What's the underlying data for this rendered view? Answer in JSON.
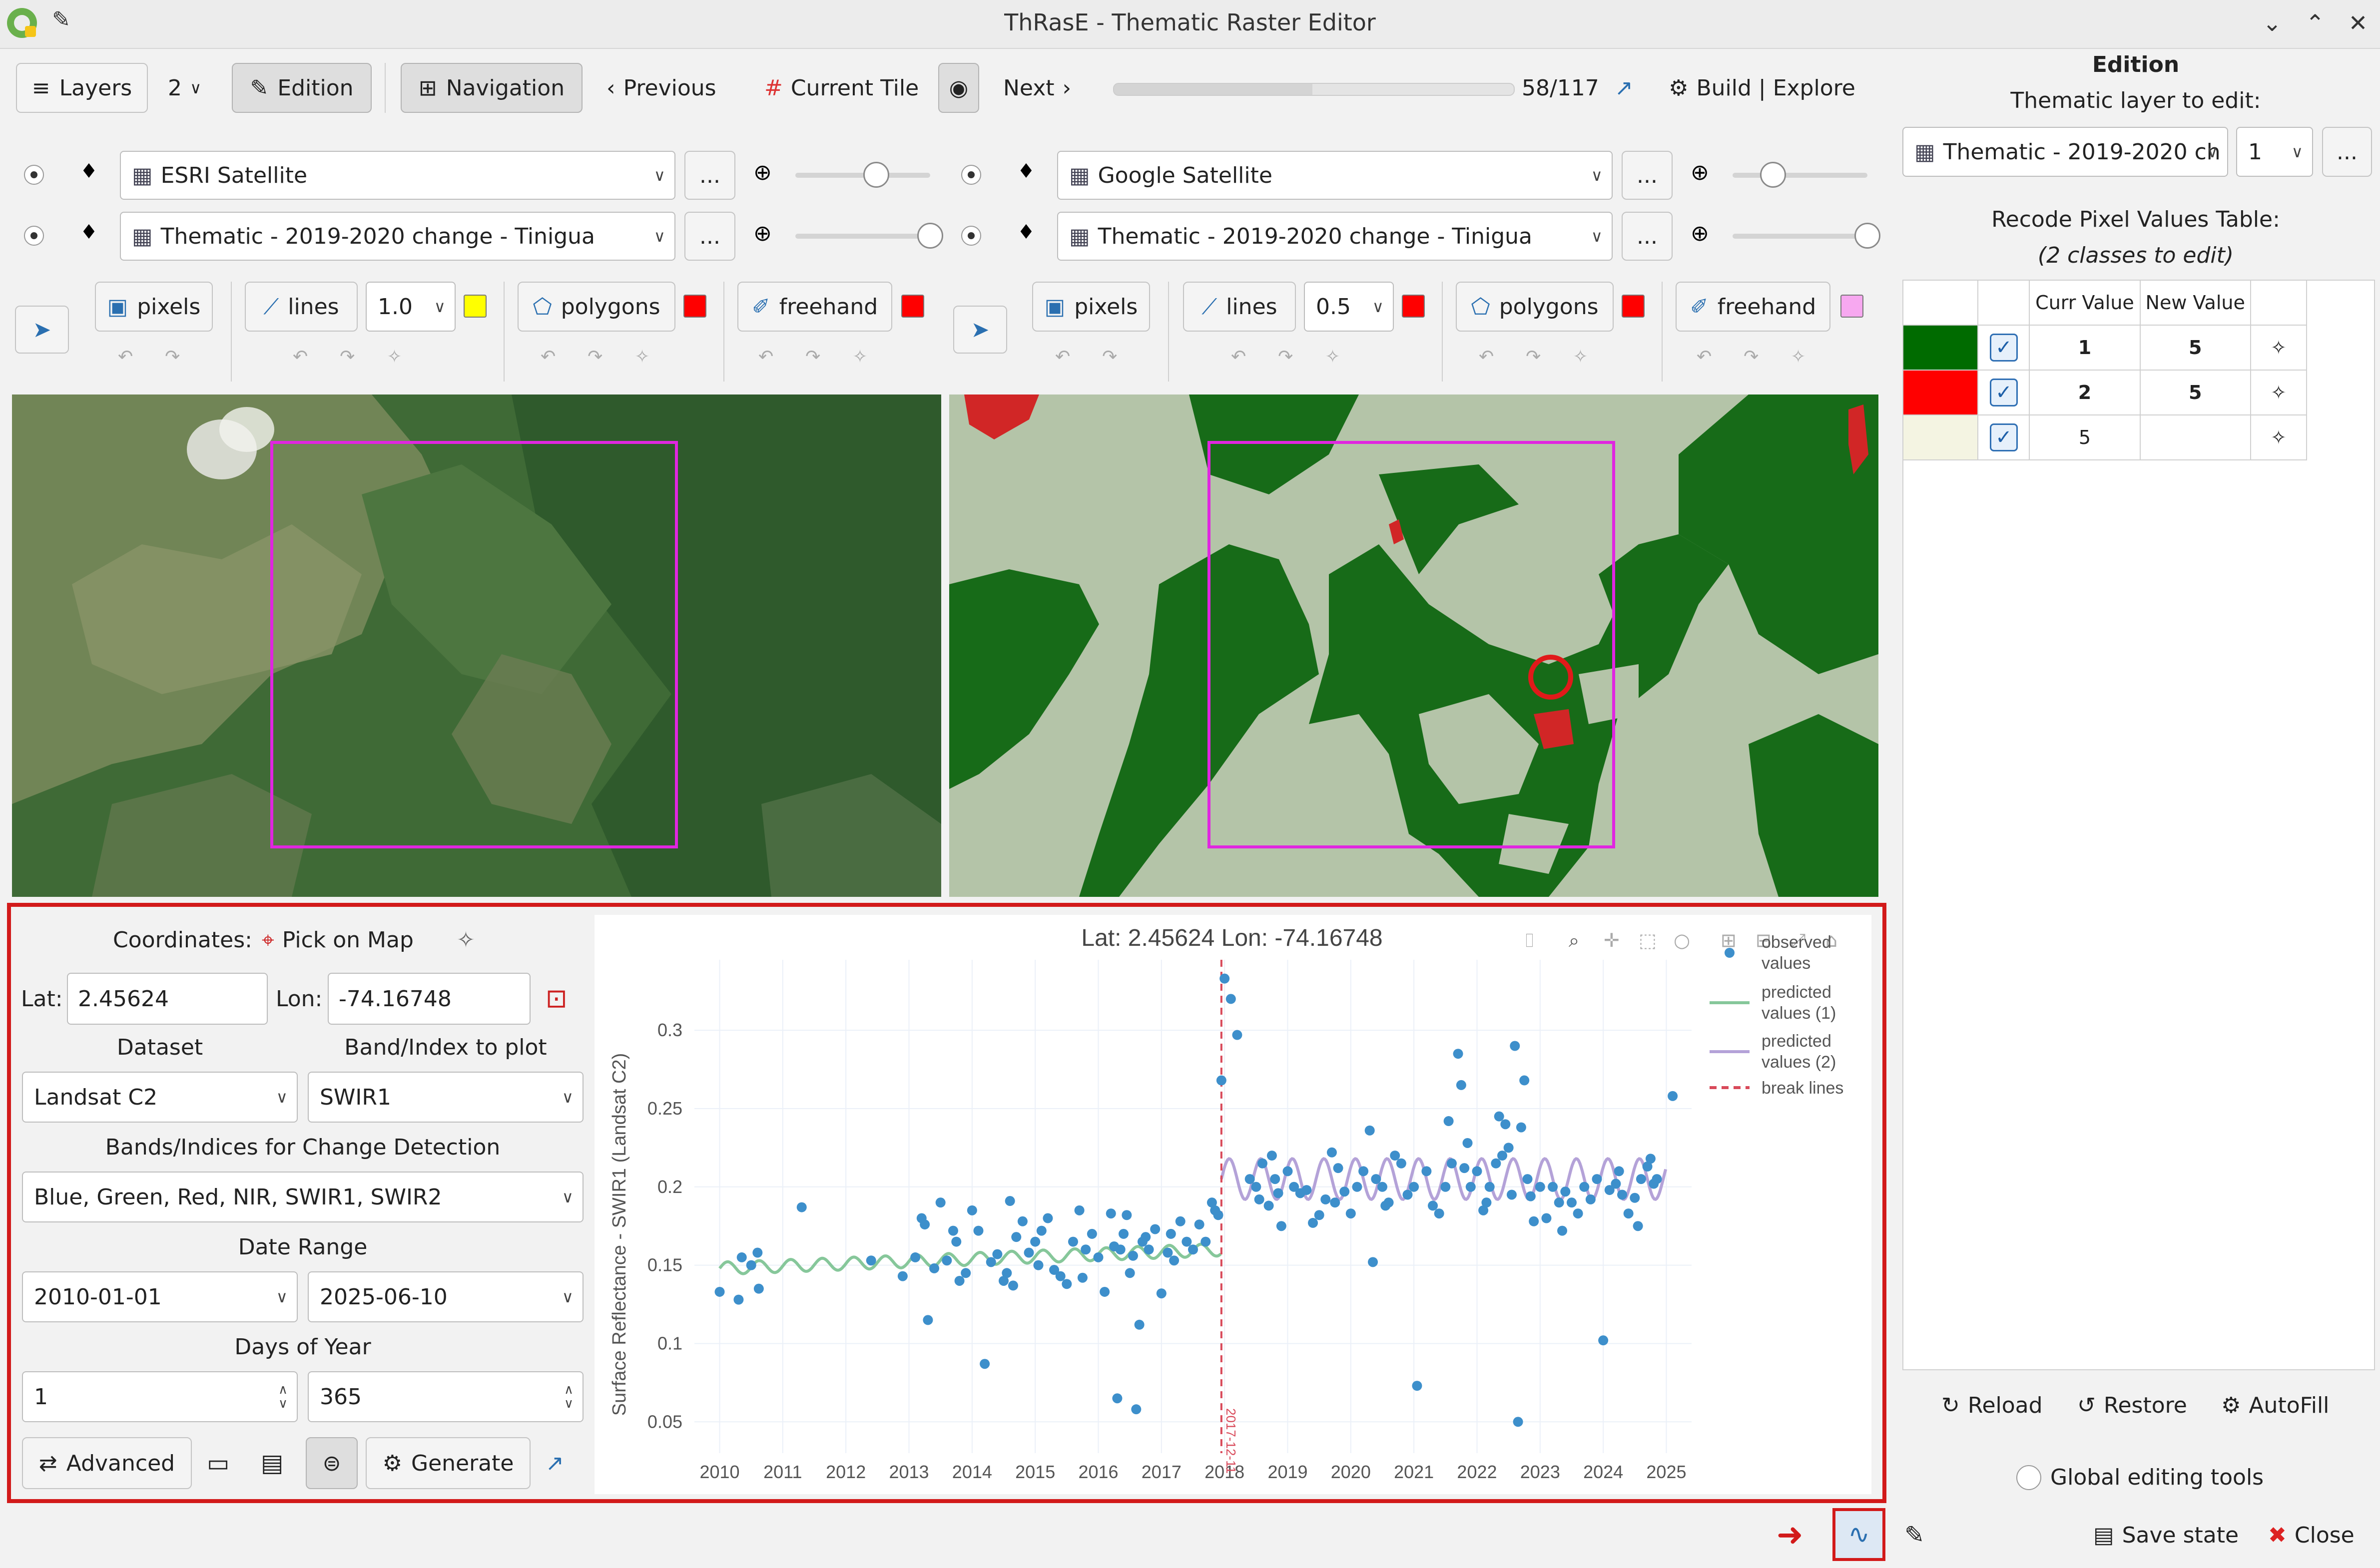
{
  "window": {
    "title": "ThRasE - Thematic Raster Editor"
  },
  "toolbar": {
    "layers_label": "Layers",
    "view_count": "2",
    "edition_label": "Edition",
    "navigation_label": "Navigation",
    "previous_label": "Previous",
    "current_tile_label": "Current Tile",
    "next_label": "Next",
    "progress": 0.4957,
    "progress_text": "58/117",
    "build_explore_label": "Build | Explore"
  },
  "views": [
    {
      "layer1": "ESRI Satellite",
      "layer2": "Thematic - 2019-2020 change - Tinigua",
      "opacity1": 0.6,
      "opacity2": 1.0,
      "tools": {
        "pixels": "pixels",
        "lines": "lines",
        "line_width": "1.0",
        "polygons": "polygons",
        "freehand": "freehand"
      },
      "colors": {
        "lines": "#ffff00",
        "polygons": "#ff0000",
        "freehand": "#ff0000"
      }
    },
    {
      "layer1": "Google Satellite",
      "layer2": "Thematic - 2019-2020 change - Tinigua",
      "opacity1": 0.3,
      "opacity2": 1.0,
      "tools": {
        "pixels": "pixels",
        "lines": "lines",
        "line_width": "0.5",
        "polygons": "polygons",
        "freehand": "freehand"
      },
      "colors": {
        "lines": "#ff0000",
        "polygons": "#ff0000",
        "freehand": "#f7a8f0"
      }
    }
  ],
  "more_label": "...",
  "edition_panel": {
    "heading": "Edition",
    "thematic_label": "Thematic layer to edit:",
    "thematic_value": "Thematic - 2019-2020 ch",
    "band_value": "1",
    "recode_label": "Recode Pixel Values Table:",
    "classes_note": "(2 classes to edit)",
    "columns": [
      "Curr Value",
      "New Value"
    ],
    "rows": [
      {
        "color": "#006b00",
        "checked": true,
        "curr": "1",
        "new": "5"
      },
      {
        "color": "#ff0000",
        "checked": true,
        "curr": "2",
        "new": "5"
      },
      {
        "color": "#f4f4e2",
        "checked": true,
        "curr": "5",
        "new": ""
      }
    ],
    "reload_label": "Reload",
    "restore_label": "Restore",
    "autofill_label": "AutoFill",
    "global_tools_label": "Global editing tools",
    "save_state_label": "Save state",
    "close_label": "Close"
  },
  "ccd": {
    "coordinates_label": "Coordinates:",
    "pick_on_map_label": "Pick on Map",
    "lat_label": "Lat:",
    "lat_value": "2.45624",
    "lon_label": "Lon:",
    "lon_value": "-74.16748",
    "dataset_label": "Dataset",
    "dataset_value": "Landsat C2",
    "band_label": "Band/Index to plot",
    "band_value": "SWIR1",
    "bands_cd_label": "Bands/Indices for Change Detection",
    "bands_cd_value": "Blue, Green, Red, NIR, SWIR1, SWIR2",
    "date_range_label": "Date Range",
    "date_start": "2010-01-01",
    "date_end": "2025-06-10",
    "doy_label": "Days of Year",
    "doy_start": "1",
    "doy_end": "365",
    "advanced_label": "Advanced",
    "generate_label": "Generate"
  },
  "chart_data": {
    "type": "scatter",
    "title": "Lat: 2.45624 Lon: -74.16748",
    "xlabel": "",
    "ylabel": "Surface Reflectance - SWIR1 (Landsat C2)",
    "xlim": [
      2009.6,
      2025.4
    ],
    "ylim": [
      0.03,
      0.345
    ],
    "x_ticks": [
      "2010",
      "2011",
      "2012",
      "2013",
      "2014",
      "2015",
      "2016",
      "2017",
      "2018",
      "2019",
      "2020",
      "2021",
      "2022",
      "2023",
      "2024",
      "2025"
    ],
    "y_ticks": [
      "0.05",
      "0.1",
      "0.15",
      "0.2",
      "0.25",
      "0.3"
    ],
    "legend": [
      "observed values",
      "predicted values (1)",
      "predicted values (2)",
      "break lines"
    ],
    "legend_position": "right",
    "break_line": {
      "x": 2017.95,
      "label": "2017-12-11"
    },
    "colors": {
      "observed": "#3d8fcb",
      "pred1": "#86c79a",
      "pred2": "#b4a2d8",
      "break": "#d94a5a"
    },
    "observed": [
      [
        2010.0,
        0.133
      ],
      [
        2010.3,
        0.128
      ],
      [
        2010.35,
        0.155
      ],
      [
        2010.5,
        0.15
      ],
      [
        2010.6,
        0.158
      ],
      [
        2010.62,
        0.135
      ],
      [
        2011.3,
        0.187
      ],
      [
        2012.4,
        0.153
      ],
      [
        2012.9,
        0.143
      ],
      [
        2013.1,
        0.155
      ],
      [
        2013.2,
        0.18
      ],
      [
        2013.25,
        0.176
      ],
      [
        2013.3,
        0.115
      ],
      [
        2013.4,
        0.148
      ],
      [
        2013.5,
        0.19
      ],
      [
        2013.6,
        0.153
      ],
      [
        2013.7,
        0.172
      ],
      [
        2013.75,
        0.165
      ],
      [
        2013.8,
        0.14
      ],
      [
        2013.9,
        0.145
      ],
      [
        2014.0,
        0.185
      ],
      [
        2014.1,
        0.172
      ],
      [
        2014.2,
        0.087
      ],
      [
        2014.3,
        0.152
      ],
      [
        2014.4,
        0.157
      ],
      [
        2014.5,
        0.14
      ],
      [
        2014.55,
        0.145
      ],
      [
        2014.6,
        0.191
      ],
      [
        2014.65,
        0.137
      ],
      [
        2014.7,
        0.168
      ],
      [
        2014.8,
        0.178
      ],
      [
        2014.9,
        0.158
      ],
      [
        2015.0,
        0.165
      ],
      [
        2015.05,
        0.15
      ],
      [
        2015.1,
        0.172
      ],
      [
        2015.2,
        0.18
      ],
      [
        2015.3,
        0.147
      ],
      [
        2015.4,
        0.143
      ],
      [
        2015.5,
        0.138
      ],
      [
        2015.6,
        0.165
      ],
      [
        2015.7,
        0.185
      ],
      [
        2015.75,
        0.142
      ],
      [
        2015.8,
        0.16
      ],
      [
        2015.9,
        0.17
      ],
      [
        2016.0,
        0.155
      ],
      [
        2016.1,
        0.133
      ],
      [
        2016.2,
        0.183
      ],
      [
        2016.25,
        0.162
      ],
      [
        2016.3,
        0.065
      ],
      [
        2016.35,
        0.16
      ],
      [
        2016.4,
        0.17
      ],
      [
        2016.45,
        0.182
      ],
      [
        2016.5,
        0.145
      ],
      [
        2016.55,
        0.156
      ],
      [
        2016.6,
        0.058
      ],
      [
        2016.65,
        0.112
      ],
      [
        2016.7,
        0.165
      ],
      [
        2016.75,
        0.168
      ],
      [
        2016.8,
        0.16
      ],
      [
        2016.9,
        0.173
      ],
      [
        2017.0,
        0.132
      ],
      [
        2017.1,
        0.158
      ],
      [
        2017.15,
        0.17
      ],
      [
        2017.2,
        0.153
      ],
      [
        2017.3,
        0.178
      ],
      [
        2017.4,
        0.165
      ],
      [
        2017.5,
        0.16
      ],
      [
        2017.6,
        0.176
      ],
      [
        2017.7,
        0.165
      ],
      [
        2017.8,
        0.19
      ],
      [
        2017.85,
        0.185
      ],
      [
        2017.9,
        0.182
      ],
      [
        2017.95,
        0.268
      ],
      [
        2018.0,
        0.333
      ],
      [
        2018.1,
        0.32
      ],
      [
        2018.2,
        0.297
      ],
      [
        2018.4,
        0.205
      ],
      [
        2018.5,
        0.2
      ],
      [
        2018.55,
        0.192
      ],
      [
        2018.6,
        0.215
      ],
      [
        2018.7,
        0.188
      ],
      [
        2018.75,
        0.22
      ],
      [
        2018.8,
        0.205
      ],
      [
        2018.85,
        0.196
      ],
      [
        2018.9,
        0.175
      ],
      [
        2019.0,
        0.21
      ],
      [
        2019.1,
        0.2
      ],
      [
        2019.2,
        0.196
      ],
      [
        2019.3,
        0.198
      ],
      [
        2019.4,
        0.177
      ],
      [
        2019.5,
        0.182
      ],
      [
        2019.6,
        0.192
      ],
      [
        2019.7,
        0.222
      ],
      [
        2019.75,
        0.19
      ],
      [
        2019.8,
        0.212
      ],
      [
        2019.9,
        0.197
      ],
      [
        2020.0,
        0.183
      ],
      [
        2020.1,
        0.2
      ],
      [
        2020.2,
        0.21
      ],
      [
        2020.3,
        0.236
      ],
      [
        2020.35,
        0.152
      ],
      [
        2020.4,
        0.205
      ],
      [
        2020.5,
        0.2
      ],
      [
        2020.55,
        0.188
      ],
      [
        2020.6,
        0.19
      ],
      [
        2020.7,
        0.22
      ],
      [
        2020.8,
        0.215
      ],
      [
        2020.9,
        0.195
      ],
      [
        2021.0,
        0.2
      ],
      [
        2021.05,
        0.073
      ],
      [
        2021.2,
        0.21
      ],
      [
        2021.3,
        0.188
      ],
      [
        2021.4,
        0.183
      ],
      [
        2021.5,
        0.2
      ],
      [
        2021.55,
        0.242
      ],
      [
        2021.6,
        0.215
      ],
      [
        2021.7,
        0.285
      ],
      [
        2021.75,
        0.265
      ],
      [
        2021.8,
        0.212
      ],
      [
        2021.85,
        0.228
      ],
      [
        2021.9,
        0.2
      ],
      [
        2022.0,
        0.21
      ],
      [
        2022.1,
        0.185
      ],
      [
        2022.15,
        0.19
      ],
      [
        2022.2,
        0.2
      ],
      [
        2022.3,
        0.215
      ],
      [
        2022.35,
        0.245
      ],
      [
        2022.4,
        0.22
      ],
      [
        2022.45,
        0.24
      ],
      [
        2022.5,
        0.225
      ],
      [
        2022.55,
        0.195
      ],
      [
        2022.6,
        0.29
      ],
      [
        2022.65,
        0.05
      ],
      [
        2022.7,
        0.238
      ],
      [
        2022.75,
        0.268
      ],
      [
        2022.8,
        0.205
      ],
      [
        2022.85,
        0.194
      ],
      [
        2022.9,
        0.178
      ],
      [
        2023.0,
        0.2
      ],
      [
        2023.1,
        0.18
      ],
      [
        2023.2,
        0.2
      ],
      [
        2023.3,
        0.19
      ],
      [
        2023.35,
        0.172
      ],
      [
        2023.4,
        0.197
      ],
      [
        2023.5,
        0.19
      ],
      [
        2023.6,
        0.183
      ],
      [
        2023.7,
        0.2
      ],
      [
        2023.8,
        0.192
      ],
      [
        2023.9,
        0.205
      ],
      [
        2024.0,
        0.102
      ],
      [
        2024.1,
        0.198
      ],
      [
        2024.2,
        0.202
      ],
      [
        2024.25,
        0.21
      ],
      [
        2024.3,
        0.195
      ],
      [
        2024.4,
        0.183
      ],
      [
        2024.5,
        0.193
      ],
      [
        2024.55,
        0.175
      ],
      [
        2024.6,
        0.205
      ],
      [
        2024.7,
        0.213
      ],
      [
        2024.75,
        0.218
      ],
      [
        2024.8,
        0.202
      ],
      [
        2024.85,
        0.205
      ],
      [
        2025.1,
        0.258
      ]
    ],
    "pred1": {
      "segment": [
        2010.0,
        2017.95
      ],
      "base": 0.148,
      "slope": 0.0015,
      "amp": 0.004,
      "period": 0.5
    },
    "pred2": {
      "segment": [
        2017.95,
        2025.0
      ],
      "base": 0.205,
      "slope": 0.0,
      "amp": 0.013,
      "period": 0.5
    }
  }
}
